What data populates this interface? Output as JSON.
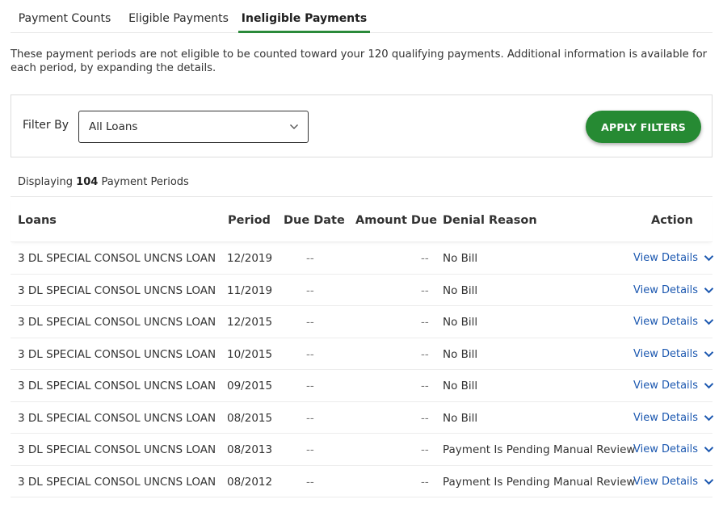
{
  "tabs": [
    {
      "label": "Payment Counts",
      "active": false
    },
    {
      "label": "Eligible Payments",
      "active": false
    },
    {
      "label": "Ineligible Payments",
      "active": true
    }
  ],
  "intro": "These payment periods are not eligible to be counted toward your 120 qualifying payments. Additional information is available for each period, by expanding the details.",
  "filter": {
    "label": "Filter By",
    "selected": "All Loans",
    "apply_label": "APPLY FILTERS"
  },
  "summary": {
    "prefix": "Displaying",
    "count": "104",
    "suffix": "Payment Periods"
  },
  "table": {
    "headers": {
      "loans": "Loans",
      "period": "Period",
      "due_date": "Due Date",
      "amount_due": "Amount Due",
      "denial_reason": "Denial Reason",
      "action": "Action"
    },
    "rows": [
      {
        "loan": "3 DL SPECIAL CONSOL UNCNS LOAN",
        "period": "12/2019",
        "due_date": "--",
        "amount_due": "--",
        "denial_reason": "No Bill",
        "action": "View Details"
      },
      {
        "loan": "3 DL SPECIAL CONSOL UNCNS LOAN",
        "period": "11/2019",
        "due_date": "--",
        "amount_due": "--",
        "denial_reason": "No Bill",
        "action": "View Details"
      },
      {
        "loan": "3 DL SPECIAL CONSOL UNCNS LOAN",
        "period": "12/2015",
        "due_date": "--",
        "amount_due": "--",
        "denial_reason": "No Bill",
        "action": "View Details"
      },
      {
        "loan": "3 DL SPECIAL CONSOL UNCNS LOAN",
        "period": "10/2015",
        "due_date": "--",
        "amount_due": "--",
        "denial_reason": "No Bill",
        "action": "View Details"
      },
      {
        "loan": "3 DL SPECIAL CONSOL UNCNS LOAN",
        "period": "09/2015",
        "due_date": "--",
        "amount_due": "--",
        "denial_reason": "No Bill",
        "action": "View Details"
      },
      {
        "loan": "3 DL SPECIAL CONSOL UNCNS LOAN",
        "period": "08/2015",
        "due_date": "--",
        "amount_due": "--",
        "denial_reason": "No Bill",
        "action": "View Details"
      },
      {
        "loan": "3 DL SPECIAL CONSOL UNCNS LOAN",
        "period": "08/2013",
        "due_date": "--",
        "amount_due": "--",
        "denial_reason": "Payment Is Pending Manual Review",
        "action": "View Details"
      },
      {
        "loan": "3 DL SPECIAL CONSOL UNCNS LOAN",
        "period": "08/2012",
        "due_date": "--",
        "amount_due": "--",
        "denial_reason": "Payment Is Pending Manual Review",
        "action": "View Details"
      }
    ]
  },
  "colors": {
    "accent_green": "#268a33",
    "link_blue": "#1c58b0"
  }
}
